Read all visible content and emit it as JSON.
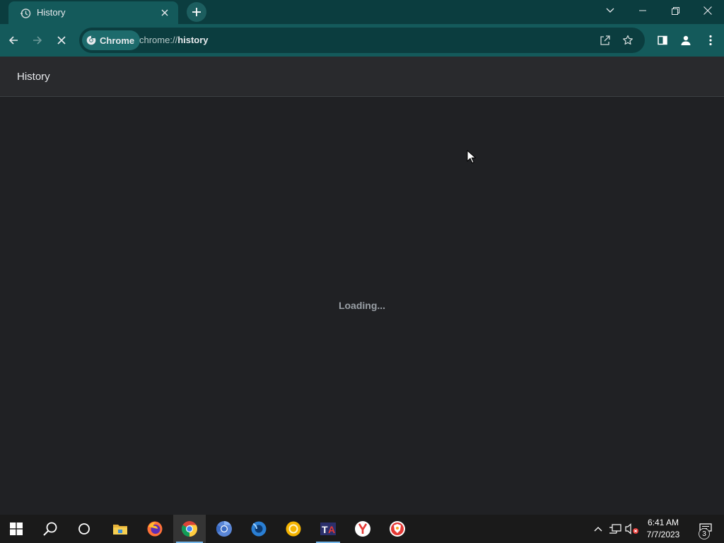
{
  "browser": {
    "tab": {
      "title": "History",
      "icon": "history-icon"
    },
    "new_tab_icon": "plus-icon",
    "window_controls": [
      "tab-search-chevron",
      "minimize",
      "restore",
      "close"
    ]
  },
  "toolbar": {
    "chip_label": "Chrome",
    "url_scheme": "chrome://",
    "url_host": "history",
    "icons": [
      "back-arrow-icon",
      "forward-arrow-icon",
      "stop-loading-icon",
      "share-icon",
      "bookmark-star-icon",
      "side-panel-icon",
      "profile-icon",
      "menu-kebab-icon"
    ]
  },
  "page": {
    "title": "History",
    "loading_text": "Loading..."
  },
  "taskbar": {
    "apps": [
      "start",
      "search",
      "cortana",
      "file-explorer",
      "firefox",
      "chrome",
      "chromium",
      "waterfox",
      "yellow-browser",
      "tor-browser",
      "yandex",
      "brave"
    ],
    "active_app": "chrome",
    "clock": {
      "time": "6:41 AM",
      "date": "7/7/2023"
    },
    "notification_count": "3"
  },
  "colors": {
    "tabstrip_bg": "#0b3d3f",
    "toolbar_bg": "#145a5b",
    "page_bg": "#202124",
    "header_bg": "#292a2d",
    "taskbar_bg": "#1a1a1a",
    "accent": "#76b9ed"
  }
}
